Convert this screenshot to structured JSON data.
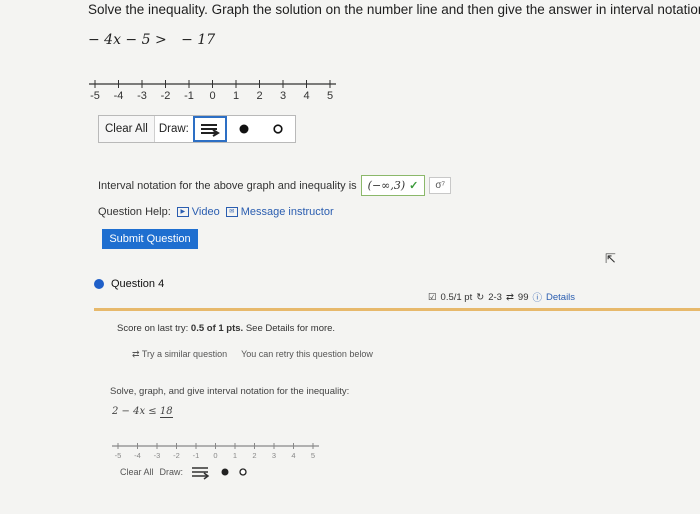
{
  "question3": {
    "instructions": "Solve the inequality. Graph the solution on the number line and then give the answer in interval notation.",
    "inequality": {
      "lhs": "− 4x − 5 >",
      "rhs": "− 17"
    },
    "number_line": {
      "ticks": [
        "-5",
        "-4",
        "-3",
        "-2",
        "-1",
        "0",
        "1",
        "2",
        "3",
        "4",
        "5"
      ]
    },
    "toolbar": {
      "clear_label": "Clear All",
      "draw_label": "Draw:"
    },
    "interval_label": "Interval notation for the above graph and inequality is",
    "interval_answer": "(−∞,3)",
    "check_mark": "✓",
    "answer_flag": "σ⁷",
    "help": {
      "label": "Question Help:",
      "video": "Video",
      "message": "Message instructor"
    },
    "submit_label": "Submit Question"
  },
  "question4": {
    "title": "Question 4",
    "meta": {
      "points": "0.5/1 pt",
      "retries": "2-3",
      "attempts": "99",
      "details": "Details"
    },
    "score_prefix": "Score on last try:",
    "score_bold": "0.5 of 1 pts.",
    "score_suffix": "See Details for more.",
    "try_similar": "Try a similar question",
    "retry_note": "You can retry this question below",
    "instructions": "Solve, graph, and give interval notation for the inequality:",
    "inequality": {
      "lhs": "2 − 4x",
      "rel": "≤",
      "rhs": "18"
    },
    "number_line": {
      "ticks": [
        "-5",
        "-4",
        "-3",
        "-2",
        "-1",
        "0",
        "1",
        "2",
        "3",
        "4",
        "5"
      ]
    },
    "toolbar": {
      "clear_label": "Clear All",
      "draw_label": "Draw:"
    }
  },
  "colors": {
    "accent": "#1f6fd0",
    "link": "#2a5db0",
    "correct": "#3a9a3a",
    "highlight_rule": "#e7b96c"
  },
  "icons": [
    "arrow-tool-icon",
    "closed-dot-icon",
    "open-dot-icon",
    "check-icon",
    "video-icon",
    "message-icon",
    "points-icon",
    "retry-icon",
    "attempts-icon",
    "info-icon",
    "cursor-icon"
  ]
}
